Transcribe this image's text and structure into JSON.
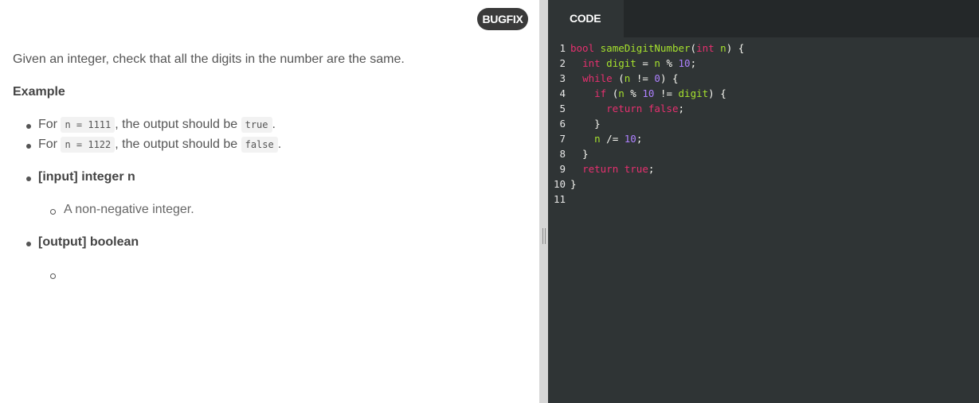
{
  "badge": "BUGFIX",
  "description": {
    "intro": "Given an integer, check that all the digits in the number are the same.",
    "example_heading": "Example",
    "examples": [
      {
        "prefix": "For ",
        "code": "n = 1111",
        "middle": ", the output should be ",
        "result": "true",
        "suffix": "."
      },
      {
        "prefix": "For ",
        "code": "n = 1122",
        "middle": ", the output should be ",
        "result": "false",
        "suffix": "."
      }
    ],
    "input_heading": "[input] integer n",
    "input_desc": "A non-negative integer.",
    "output_heading": "[output] boolean",
    "output_desc": ""
  },
  "editor": {
    "tab_label": "CODE",
    "line_numbers": [
      "1",
      "2",
      "3",
      "4",
      "5",
      "6",
      "7",
      "8",
      "9",
      "10",
      "11"
    ],
    "lines": [
      "bool sameDigitNumber(int n) {",
      "  int digit = n % 10;",
      "  while (n != 0) {",
      "    if (n % 10 != digit) {",
      "      return false;",
      "    }",
      "    n /= 10;",
      "  }",
      "  return true;",
      "}",
      ""
    ]
  },
  "colors": {
    "keyword": "#e6306f",
    "identifier": "#a6e22e",
    "number": "#ae81ff",
    "editor_bg": "#2f3435",
    "badge_bg": "#3a3a3a"
  }
}
